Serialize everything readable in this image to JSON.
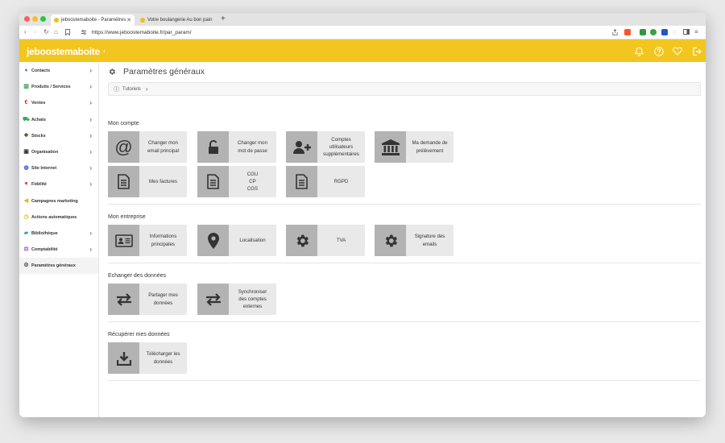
{
  "browser": {
    "tabs": [
      {
        "label": "jeboostemaboite - Paramètres"
      },
      {
        "label": "Votre boulangerie Au bon pain"
      }
    ],
    "new_tab": "+",
    "url": "https://www.jeboostemaboite.fr/par_param/"
  },
  "app": {
    "logo": "jeboostemaboite",
    "accent": "#f2c61f"
  },
  "sidebar": {
    "items": [
      {
        "label": "Contacts",
        "icon": "users-icon",
        "color": "#3d8ddb",
        "arrow": true
      },
      {
        "label": "Produits / Services",
        "icon": "books-icon",
        "color": "#3a9e53",
        "arrow": true
      },
      {
        "label": "Ventes",
        "icon": "euro-icon",
        "color": "#d9302c",
        "arrow": true
      },
      {
        "label": "Achats",
        "icon": "cart-icon",
        "color": "#34a853",
        "arrow": true
      },
      {
        "label": "Stocks",
        "icon": "cubes-icon",
        "color": "#6d4c41",
        "arrow": true
      },
      {
        "label": "Organisation",
        "icon": "calendar-icon",
        "color": "#333333",
        "arrow": true
      },
      {
        "label": "Site Internet",
        "icon": "globe-icon",
        "color": "#2a5bd7",
        "arrow": true
      },
      {
        "label": "Fidélité",
        "icon": "heart-icon",
        "color": "#d9302c",
        "arrow": true
      },
      {
        "label": "Campagnes marketing",
        "icon": "megaphone-icon",
        "color": "#e2b619",
        "arrow": false
      },
      {
        "label": "Actions automatiques",
        "icon": "clock-icon",
        "color": "#d4c311",
        "arrow": false
      },
      {
        "label": "Bibliothèque",
        "icon": "folder-icon",
        "color": "#2a9bd7",
        "arrow": true
      },
      {
        "label": "Comptabilité",
        "icon": "balance-icon",
        "color": "#a54dc7",
        "arrow": true
      },
      {
        "label": "Paramètres généraux",
        "icon": "gear-icon",
        "color": "#555555",
        "arrow": false
      }
    ]
  },
  "main": {
    "title": "Paramètres généraux",
    "tutorials": "Tutoriels",
    "sections": [
      {
        "title": "Mon compte",
        "cards": [
          {
            "label": "Changer mon\nemail principal",
            "icon": "at-icon"
          },
          {
            "label": "Changer mon\nmot de passe",
            "icon": "unlock-icon"
          },
          {
            "label": "Comptes\nutilisateurs\nsupplémentaires",
            "icon": "user-plus-icon"
          },
          {
            "label": "Ma demande de\nprélèvement",
            "icon": "bank-icon"
          },
          {
            "label": "Mes factures",
            "icon": "document-icon"
          },
          {
            "label": "CGU\nCP\nCGS",
            "icon": "document-icon"
          },
          {
            "label": "RGPD",
            "icon": "document-icon"
          }
        ]
      },
      {
        "title": "Mon entreprise",
        "cards": [
          {
            "label": "Informations\nprincipales",
            "icon": "id-card-icon"
          },
          {
            "label": "Localisation",
            "icon": "map-pin-icon"
          },
          {
            "label": "TVA",
            "icon": "gear-icon"
          },
          {
            "label": "Signature des\nemails",
            "icon": "gear-icon"
          }
        ]
      },
      {
        "title": "Echanger des données",
        "cards": [
          {
            "label": "Partager mes\ndonnées",
            "icon": "exchange-icon"
          },
          {
            "label": "Synchroniser\ndes comptes\nexternes",
            "icon": "exchange-icon"
          }
        ]
      },
      {
        "title": "Récupérer mes données",
        "cards": [
          {
            "label": "Télécharger les\ndonnées",
            "icon": "download-icon"
          }
        ]
      }
    ]
  }
}
